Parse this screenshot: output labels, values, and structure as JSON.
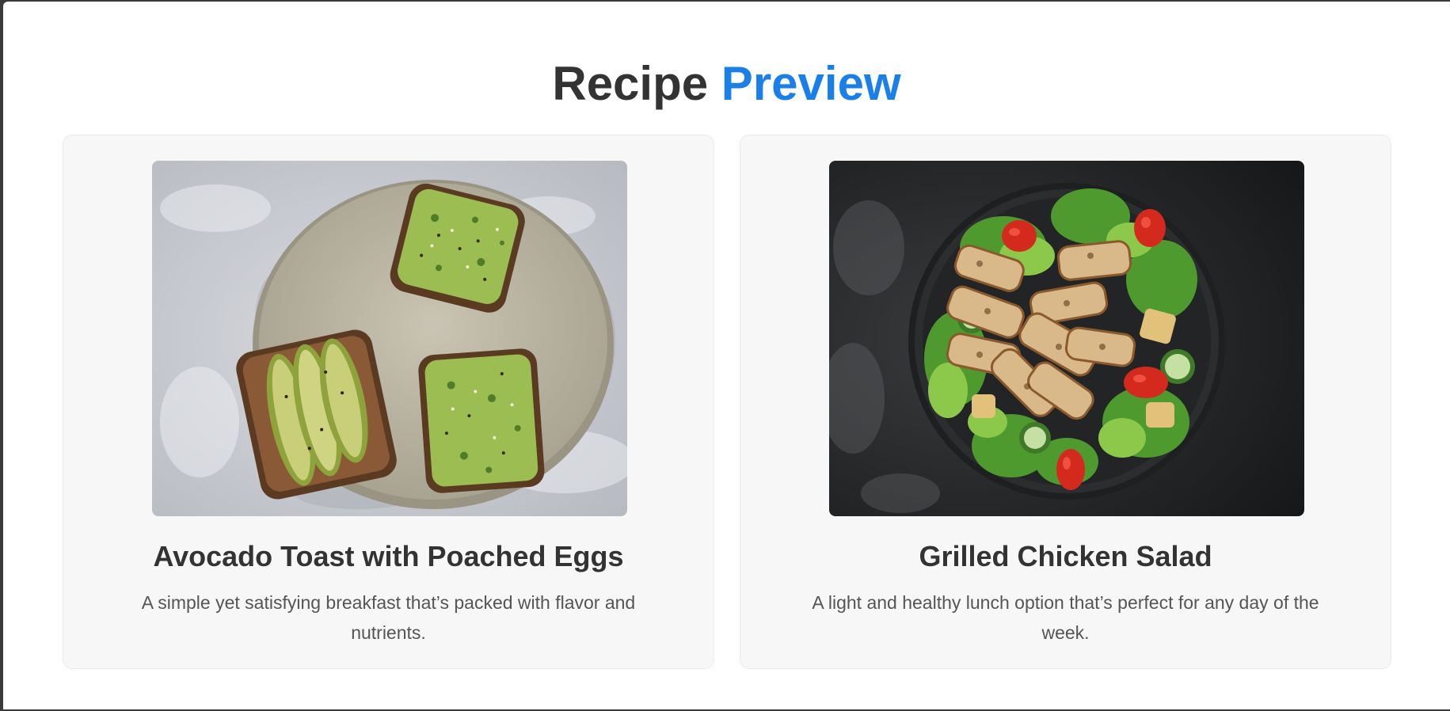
{
  "page": {
    "heading_part1": "Recipe",
    "heading_part2": "Preview",
    "accent_color": "#1a7fe8"
  },
  "recipes": [
    {
      "title": "Avocado Toast with Poached Eggs",
      "description": "A simple yet satisfying breakfast that’s packed with flavor and nutrients.",
      "image": "avocado-toast-photo"
    },
    {
      "title": "Grilled Chicken Salad",
      "description": "A light and healthy lunch option that’s perfect for any day of the week.",
      "image": "grilled-chicken-salad-photo"
    }
  ]
}
